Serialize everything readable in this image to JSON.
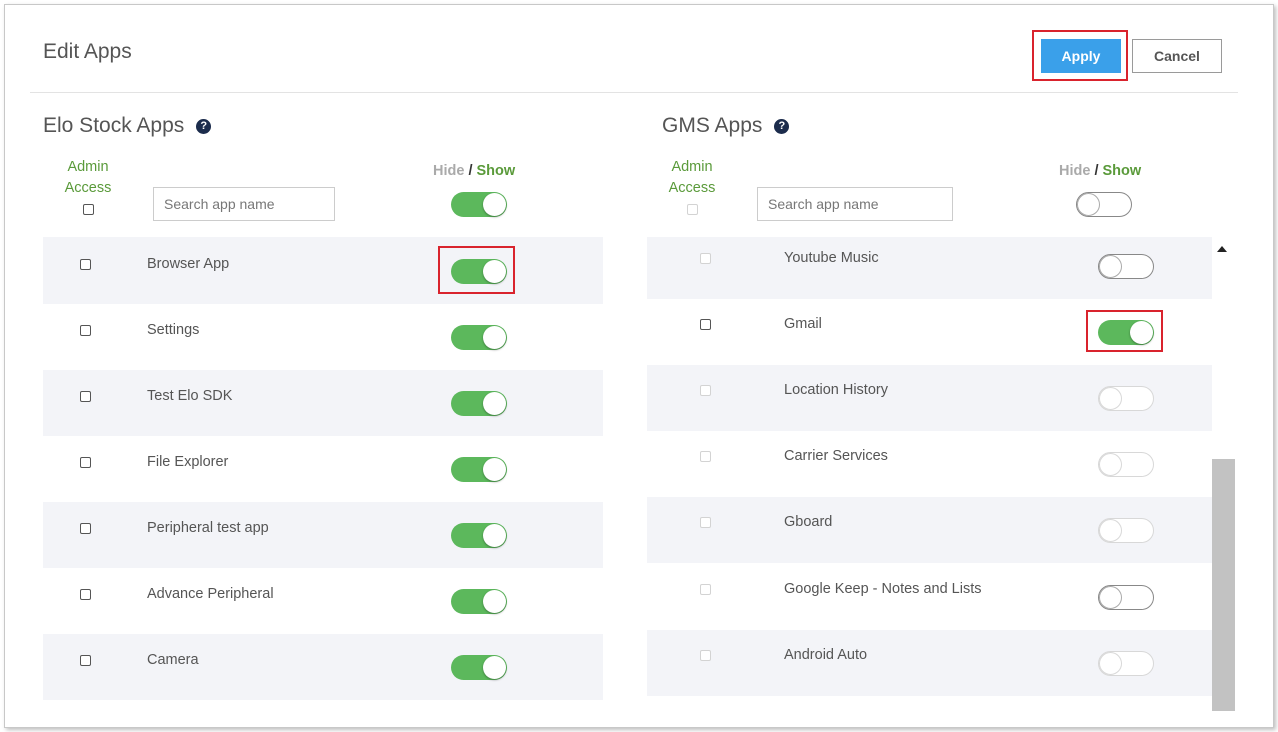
{
  "header": {
    "title": "Edit Apps",
    "apply_label": "Apply",
    "cancel_label": "Cancel"
  },
  "left": {
    "title": "Elo Stock Apps",
    "help_glyph": "?",
    "admin_line1": "Admin",
    "admin_line2": "Access",
    "hide_label": "Hide",
    "slash": "/",
    "show_label": "Show",
    "search_placeholder": "Search app name",
    "master_toggle": "on",
    "apps": [
      {
        "name": "Browser App",
        "toggle": "on"
      },
      {
        "name": "Settings",
        "toggle": "on"
      },
      {
        "name": "Test Elo SDK",
        "toggle": "on"
      },
      {
        "name": "File Explorer",
        "toggle": "on"
      },
      {
        "name": "Peripheral test app",
        "toggle": "on"
      },
      {
        "name": "Advance Peripheral",
        "toggle": "on"
      },
      {
        "name": "Camera",
        "toggle": "on"
      }
    ]
  },
  "right": {
    "title": "GMS Apps",
    "help_glyph": "?",
    "admin_line1": "Admin",
    "admin_line2": "Access",
    "hide_label": "Hide",
    "slash": "/",
    "show_label": "Show",
    "search_placeholder": "Search app name",
    "master_toggle": "off",
    "apps": [
      {
        "name": "Youtube Music",
        "toggle": "off"
      },
      {
        "name": "Gmail",
        "toggle": "on"
      },
      {
        "name": "Location History",
        "toggle": "disabled"
      },
      {
        "name": "Carrier Services",
        "toggle": "disabled"
      },
      {
        "name": "Gboard",
        "toggle": "disabled"
      },
      {
        "name": "Google Keep - Notes and Lists",
        "toggle": "off"
      },
      {
        "name": "Android Auto",
        "toggle": "disabled"
      }
    ]
  },
  "colors": {
    "accent_green": "#5cb85c",
    "apply_blue": "#3aa0ea",
    "highlight_red": "#d9232d"
  },
  "icons": {
    "help": "question-circle-icon",
    "scroll_up": "triangle-up-icon"
  }
}
